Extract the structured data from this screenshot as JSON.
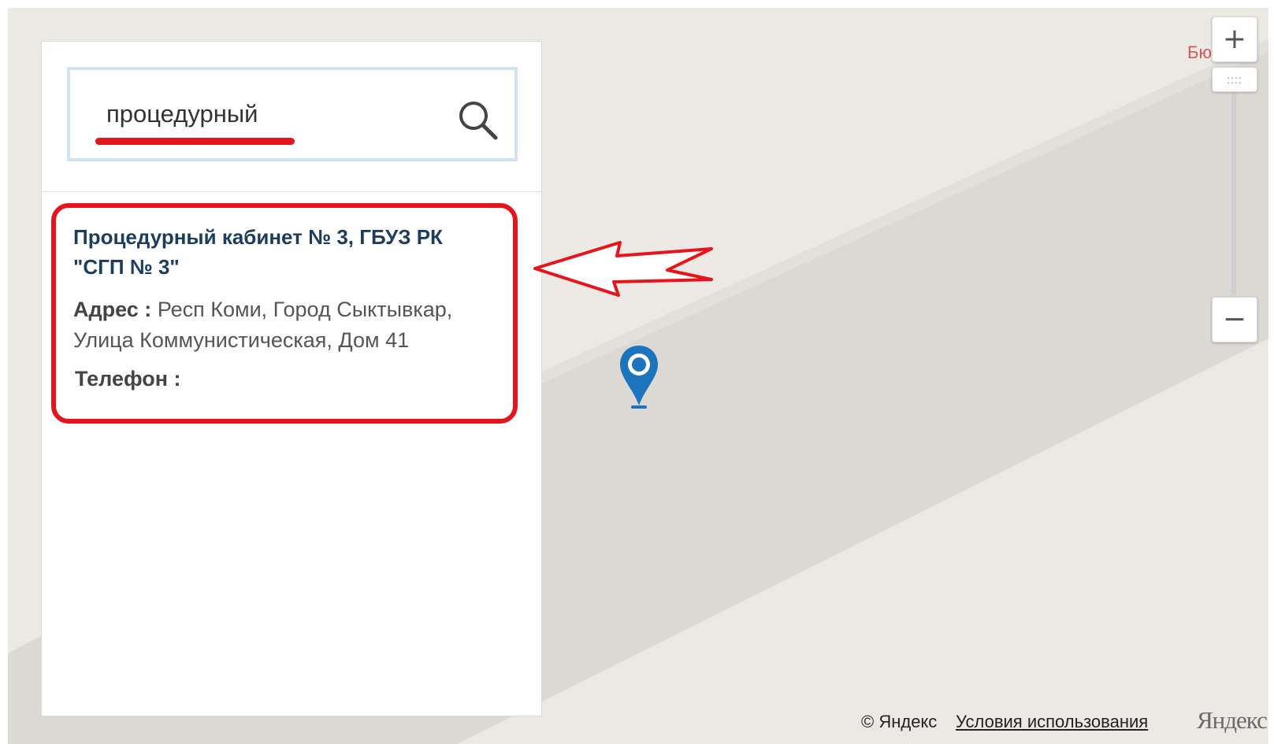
{
  "map": {
    "poi_label": "Бю",
    "zoom_in_icon": "plus-icon",
    "zoom_out_icon": "minus-icon",
    "zoom_handle_icon": "grip-icon",
    "zoom_handle_text": "::::",
    "marker_icon": "map-pin-icon",
    "colors": {
      "land": "#ece9e4",
      "road": "#d9d6d2",
      "marker": "#1c75bc",
      "poi": "#d35a5a"
    }
  },
  "search": {
    "value": "процедурный",
    "icon": "search-icon"
  },
  "result": {
    "title": "Процедурный кабинет № 3, ГБУЗ РК \"СГП № 3\"",
    "address_label": "Адрес :",
    "address_value": "Респ Коми, Город Сыктывкар, Улица Коммунистическая, Дом 41",
    "phone_label": "Телефон :"
  },
  "annotation": {
    "highlight_color": "#e8141b",
    "arrow_icon": "arrow-left-icon"
  },
  "footer": {
    "copyright": "© Яндекс",
    "terms_link": "Условия использования",
    "logo": "Яндекс"
  }
}
